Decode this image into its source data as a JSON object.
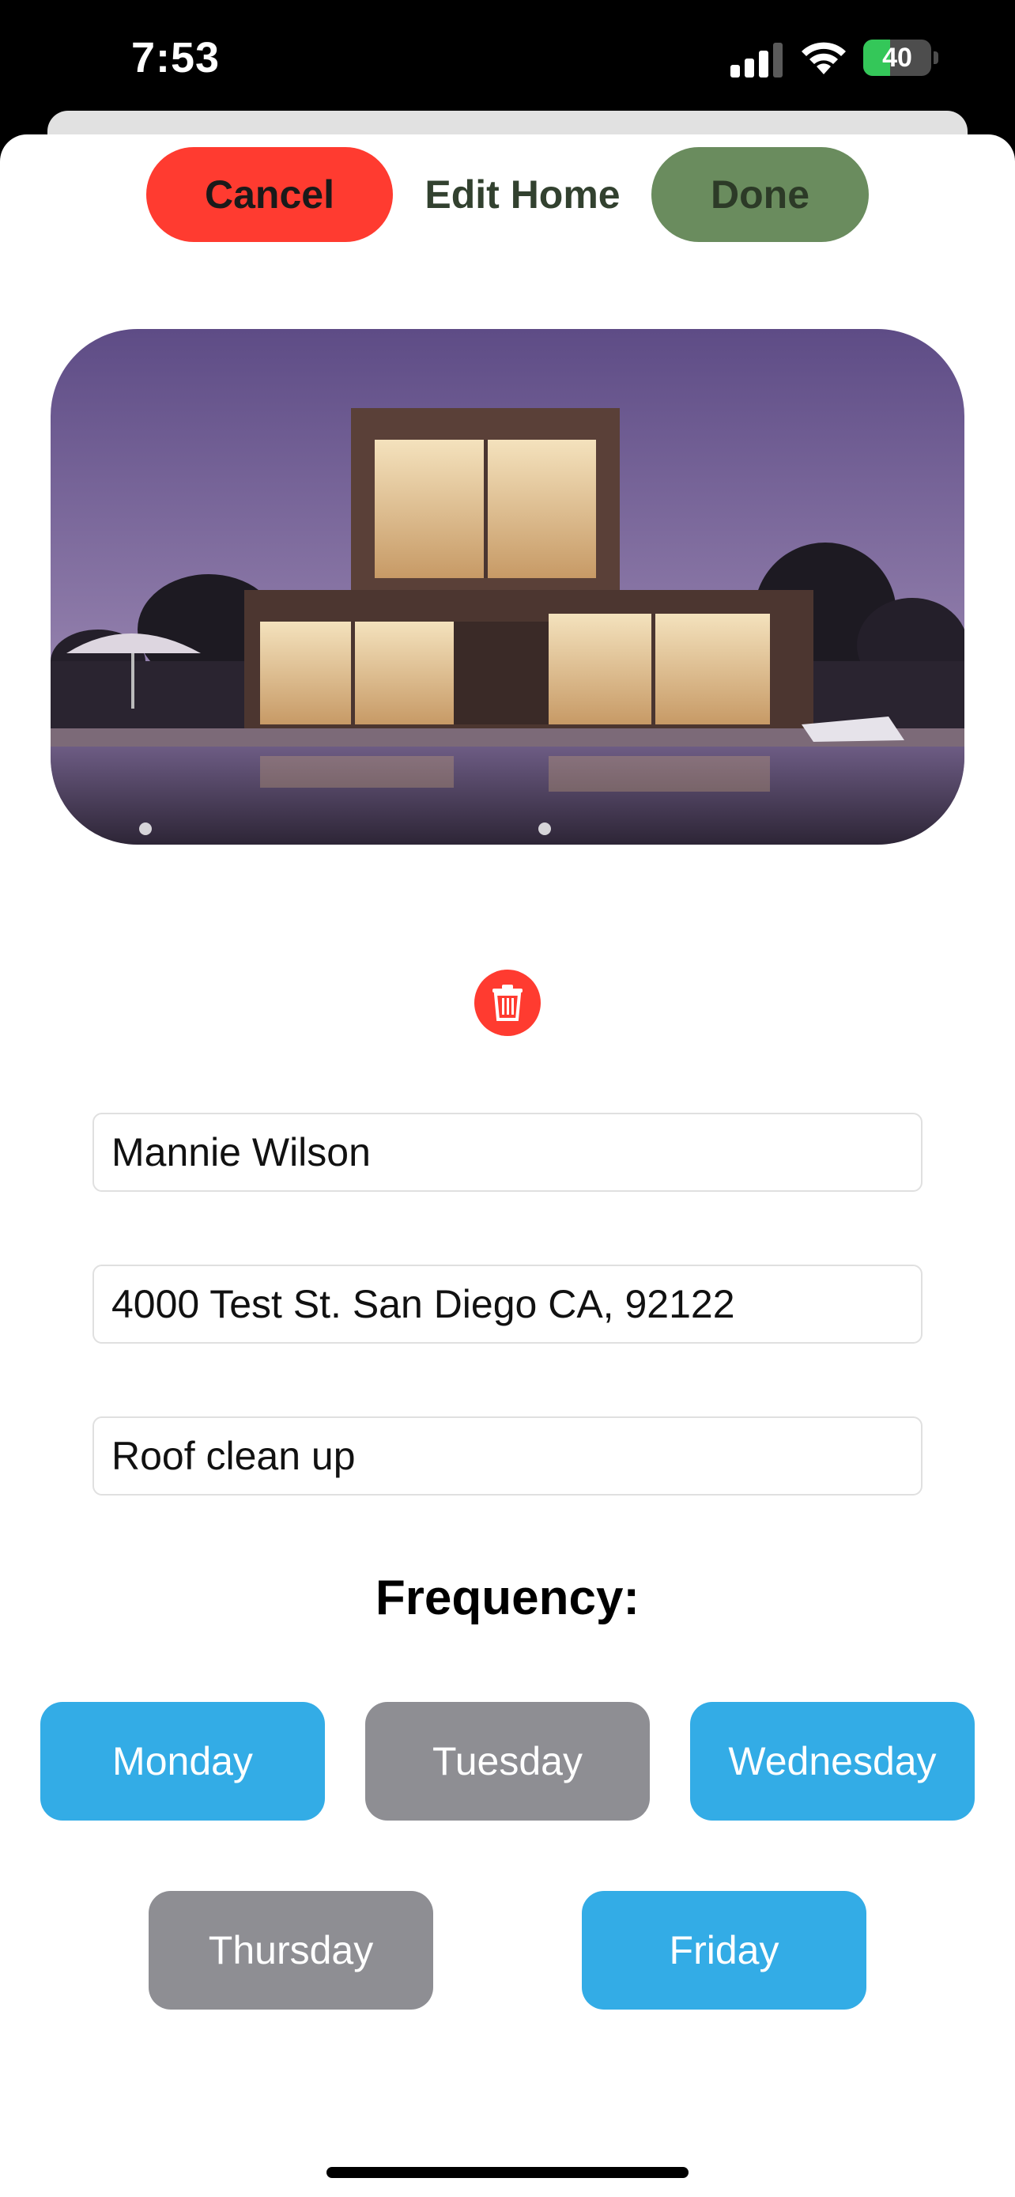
{
  "status_bar": {
    "time": "7:53",
    "battery_level": "40",
    "battery_percent": 40,
    "charging": true
  },
  "nav": {
    "cancel_label": "Cancel",
    "title": "Edit Home",
    "done_label": "Done"
  },
  "colors": {
    "cancel": "#ff3b30",
    "done": "#6a8c5e",
    "day_selected": "#33ace6",
    "day_unselected": "#8e8e93",
    "delete": "#ff3b30"
  },
  "form": {
    "name": "Mannie Wilson",
    "address": "4000 Test St. San Diego CA, 92122",
    "service": "Roof clean up"
  },
  "frequency": {
    "label": "Frequency:",
    "days": [
      {
        "label": "Monday",
        "selected": true
      },
      {
        "label": "Tuesday",
        "selected": false
      },
      {
        "label": "Wednesday",
        "selected": true
      },
      {
        "label": "Thursday",
        "selected": false
      },
      {
        "label": "Friday",
        "selected": true
      }
    ]
  },
  "icons": {
    "delete": "trash-icon",
    "signal": "cellular-signal-icon",
    "wifi": "wifi-icon",
    "battery": "battery-icon"
  }
}
